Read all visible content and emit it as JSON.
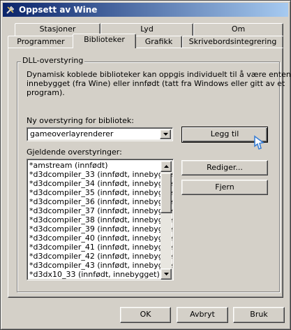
{
  "window": {
    "title": "Oppsett av Wine"
  },
  "tabs": {
    "row_top": [
      "Stasjoner",
      "Lyd",
      "Om"
    ],
    "row_bottom": [
      "Programmer",
      "Biblioteker",
      "Grafikk",
      "Skrivebordsintegrering"
    ],
    "active": "Biblioteker"
  },
  "group": {
    "label": "DLL-overstyring",
    "description_lines": [
      "Dynamisk koblede biblioteker kan oppgis individuelt til å være enten",
      "innebygget (fra Wine) eller innfødt (tatt fra Windows eller gitt av et",
      "program)."
    ],
    "new_override_label": "Ny overstyring for bibliotek:",
    "new_override_value": "gameoverlayrenderer",
    "add_button": "Legg til",
    "existing_label": "Gjeldende overstyringer:",
    "overrides": [
      "*amstream (innfødt)",
      "*d3dcompiler_33 (innfødt, innebygget)",
      "*d3dcompiler_34 (innfødt, innebygget)",
      "*d3dcompiler_35 (innfødt, innebygget)",
      "*d3dcompiler_36 (innfødt, innebygget)",
      "*d3dcompiler_37 (innfødt, innebygget)",
      "*d3dcompiler_38 (innfødt, innebygget)",
      "*d3dcompiler_39 (innfødt, innebygget)",
      "*d3dcompiler_40 (innfødt, innebygget)",
      "*d3dcompiler_41 (innfødt, innebygget)",
      "*d3dcompiler_42 (innfødt, innebygget)",
      "*d3dcompiler_43 (innfødt, innebygget)",
      "*d3dx10_33 (innfødt, innebygget)"
    ],
    "edit_button": "Rediger...",
    "remove_button": "Fjern"
  },
  "footer": {
    "ok": "OK",
    "cancel": "Avbryt",
    "apply": "Bruk"
  },
  "colors": {
    "titlebar_start": "#0a246a",
    "titlebar_end": "#a6caf0",
    "face": "#d4d0c8"
  }
}
